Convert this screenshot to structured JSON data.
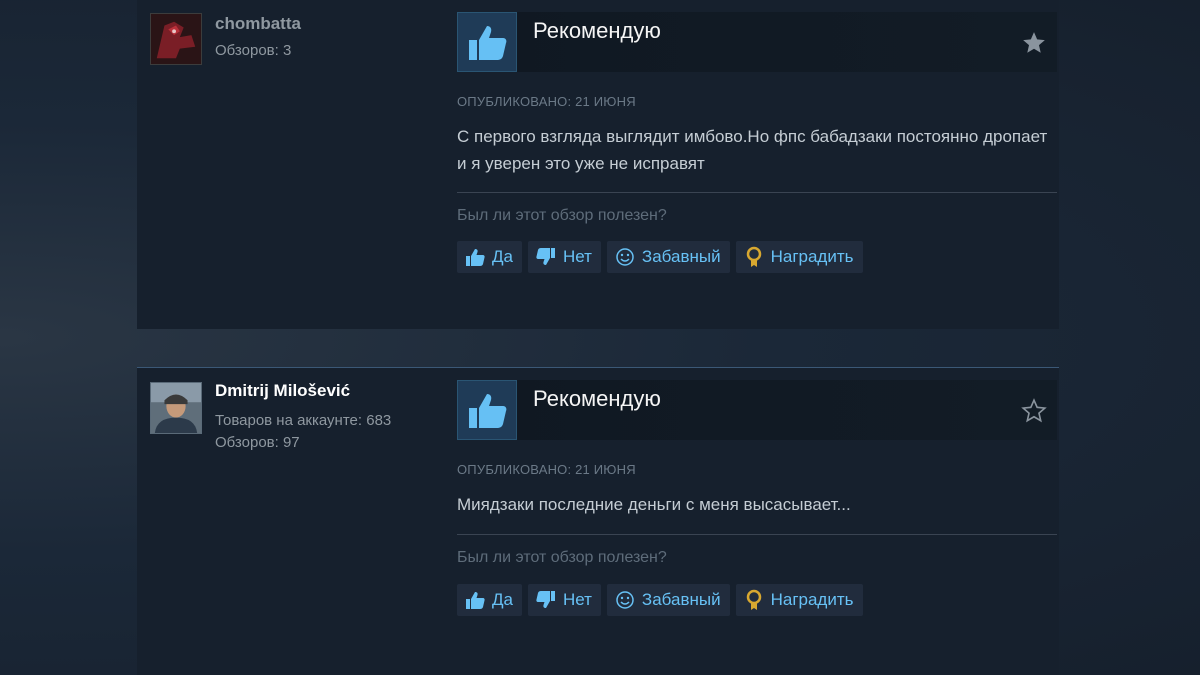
{
  "reviews": [
    {
      "author": "chombatta",
      "meta": [
        "Обзоров: 3"
      ],
      "vote": "Рекомендую",
      "posted": "ОПУБЛИКОВАНО: 21 ИЮНЯ",
      "content": "С первого взгляда выглядит имбово.Но фпс бабадзаки постоянно дропает и я уверен это уже не исправят",
      "helpful_prompt": "Был ли этот обзор полезен?",
      "buttons": {
        "yes": "Да",
        "no": "Нет",
        "funny": "Забавный",
        "award": "Наградить"
      },
      "star": "filled"
    },
    {
      "author": "Dmitrij Milošević",
      "meta": [
        "Товаров на аккаунте: 683",
        "Обзоров: 97"
      ],
      "vote": "Рекомендую",
      "posted": "ОПУБЛИКОВАНО: 21 ИЮНЯ",
      "content": "Миядзаки последние деньги с меня высасывает...",
      "helpful_prompt": "Был ли этот обзор полезен?",
      "buttons": {
        "yes": "Да",
        "no": "Нет",
        "funny": "Забавный",
        "award": "Наградить"
      },
      "star": "outline"
    }
  ],
  "colors": {
    "background": "#1b2838",
    "panel": "#16202d",
    "link": "#67c1f5",
    "award": "#d8a830"
  }
}
